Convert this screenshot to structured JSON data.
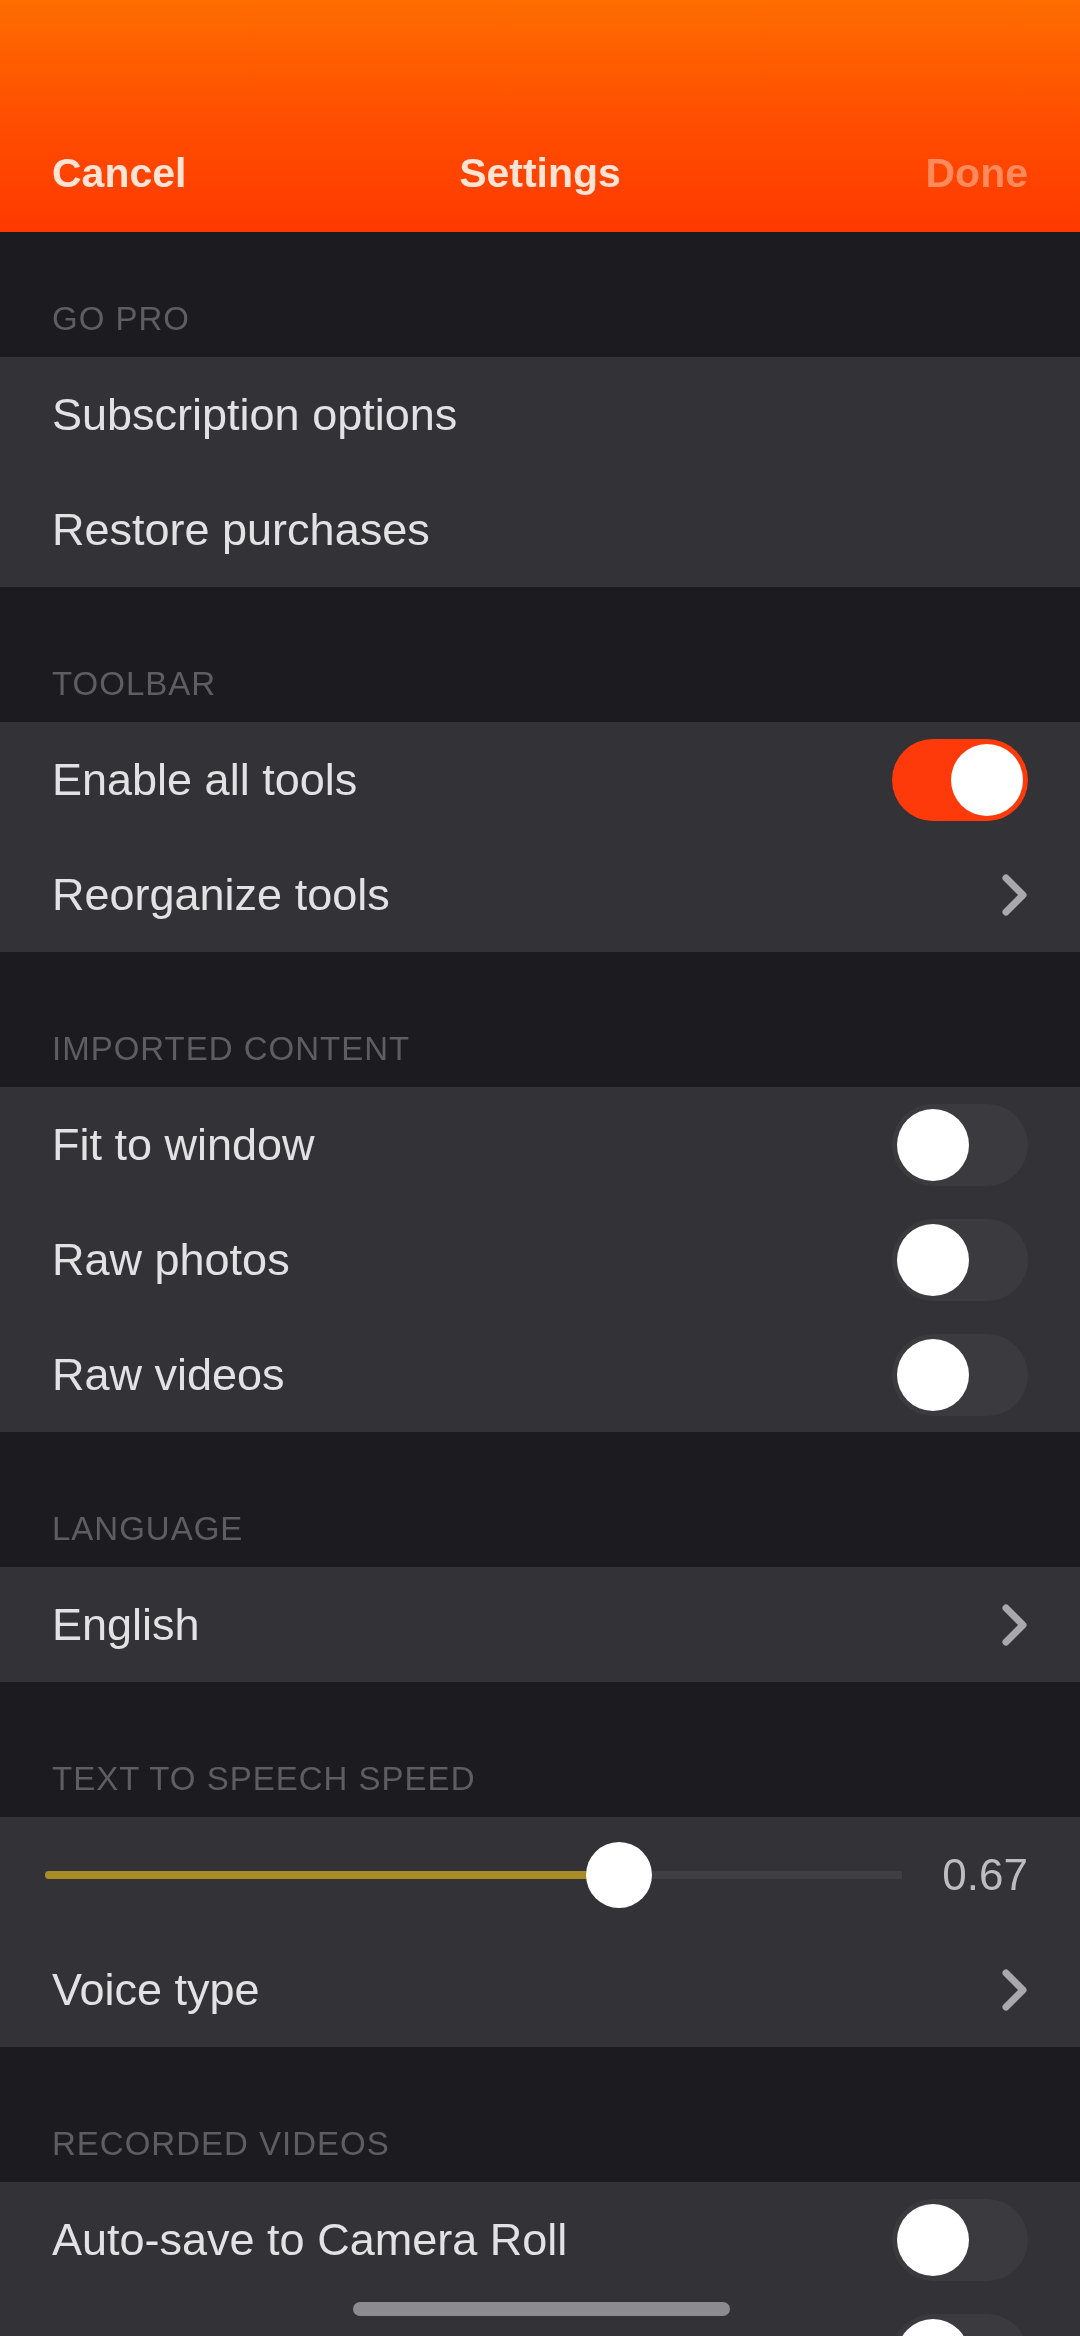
{
  "nav": {
    "cancel": "Cancel",
    "title": "Settings",
    "done": {
      "label": "Done",
      "disabled": true
    }
  },
  "sections": [
    {
      "header": "GO PRO",
      "rows": [
        {
          "kind": "action",
          "label": "Subscription options"
        },
        {
          "kind": "action",
          "label": "Restore purchases"
        }
      ]
    },
    {
      "header": "TOOLBAR",
      "rows": [
        {
          "kind": "toggle",
          "label": "Enable all tools",
          "on": true
        },
        {
          "kind": "link",
          "label": "Reorganize tools"
        }
      ]
    },
    {
      "header": "IMPORTED CONTENT",
      "rows": [
        {
          "kind": "toggle",
          "label": "Fit to window",
          "on": false
        },
        {
          "kind": "toggle",
          "label": "Raw photos",
          "on": false
        },
        {
          "kind": "toggle",
          "label": "Raw videos",
          "on": false
        }
      ]
    },
    {
      "header": "LANGUAGE",
      "rows": [
        {
          "kind": "link",
          "label": "English"
        }
      ]
    },
    {
      "header": "TEXT TO SPEECH SPEED",
      "rows": [
        {
          "kind": "slider",
          "level": 0.67,
          "reading": "0.67"
        },
        {
          "kind": "link",
          "label": "Voice type"
        }
      ]
    },
    {
      "header": "RECORDED VIDEOS",
      "rows": [
        {
          "kind": "toggle",
          "label": "Auto-save to Camera Roll",
          "on": false
        },
        {
          "kind": "toggle",
          "on": false
        }
      ]
    }
  ]
}
